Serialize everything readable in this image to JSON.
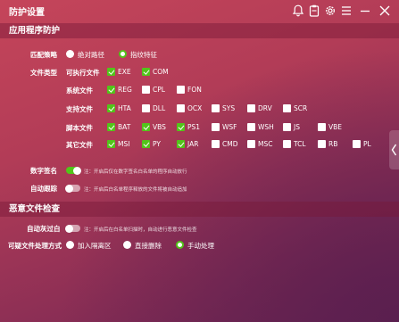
{
  "window": {
    "title": "防护设置"
  },
  "sections": {
    "app_protect": "应用程序防护",
    "malware_check": "恶意文件检查"
  },
  "match_policy": {
    "label": "匹配策略",
    "options": [
      {
        "label": "绝对路径",
        "selected": false
      },
      {
        "label": "指纹特征",
        "selected": true
      }
    ]
  },
  "file_types": {
    "label": "文件类型",
    "rows": [
      {
        "label": "可执行文件",
        "items": [
          {
            "label": "EXE",
            "checked": true
          },
          {
            "label": "COM",
            "checked": true
          }
        ]
      },
      {
        "label": "系统文件",
        "items": [
          {
            "label": "REG",
            "checked": true
          },
          {
            "label": "CPL",
            "checked": false
          },
          {
            "label": "FON",
            "checked": false
          }
        ]
      },
      {
        "label": "支持文件",
        "items": [
          {
            "label": "HTA",
            "checked": true
          },
          {
            "label": "DLL",
            "checked": false
          },
          {
            "label": "OCX",
            "checked": false
          },
          {
            "label": "SYS",
            "checked": false
          },
          {
            "label": "DRV",
            "checked": false
          },
          {
            "label": "SCR",
            "checked": false
          }
        ]
      },
      {
        "label": "脚本文件",
        "items": [
          {
            "label": "BAT",
            "checked": true
          },
          {
            "label": "VBS",
            "checked": true
          },
          {
            "label": "PS1",
            "checked": true
          },
          {
            "label": "WSF",
            "checked": false
          },
          {
            "label": "WSH",
            "checked": false
          },
          {
            "label": "JS",
            "checked": false
          },
          {
            "label": "VBE",
            "checked": false
          }
        ]
      },
      {
        "label": "其它文件",
        "items": [
          {
            "label": "MSI",
            "checked": true
          },
          {
            "label": "PY",
            "checked": true
          },
          {
            "label": "JAR",
            "checked": true
          },
          {
            "label": "CMD",
            "checked": false
          },
          {
            "label": "MSC",
            "checked": false
          },
          {
            "label": "TCL",
            "checked": false
          },
          {
            "label": "RB",
            "checked": false
          },
          {
            "label": "PL",
            "checked": false
          }
        ]
      }
    ]
  },
  "digital_sign": {
    "label": "数字签名",
    "on": true,
    "note": "注：开启后仅在数字签名白名单的程序自动放行"
  },
  "auto_track": {
    "label": "自动跟踪",
    "on": false,
    "note": "注：开启后白名单程序释放的文件将被自动追加"
  },
  "auto_whitelist": {
    "label": "自动灰过白",
    "on": false,
    "note": "注：开启后在白名单扫描时，自动进行恶意文件检查"
  },
  "suspicious_handling": {
    "label": "可疑文件处理方式",
    "options": [
      {
        "label": "加入隔离区",
        "selected": false
      },
      {
        "label": "直接删除",
        "selected": false
      },
      {
        "label": "手动处理",
        "selected": true
      }
    ]
  },
  "icons": [
    "bell-icon",
    "clipboard-icon",
    "gear-icon",
    "menu-icon",
    "minimize-icon",
    "close-icon",
    "chevron-left-icon"
  ],
  "colors": {
    "accent": "#52c41a",
    "bg_top": "#c5455a",
    "bg_bottom": "#6b2451"
  }
}
